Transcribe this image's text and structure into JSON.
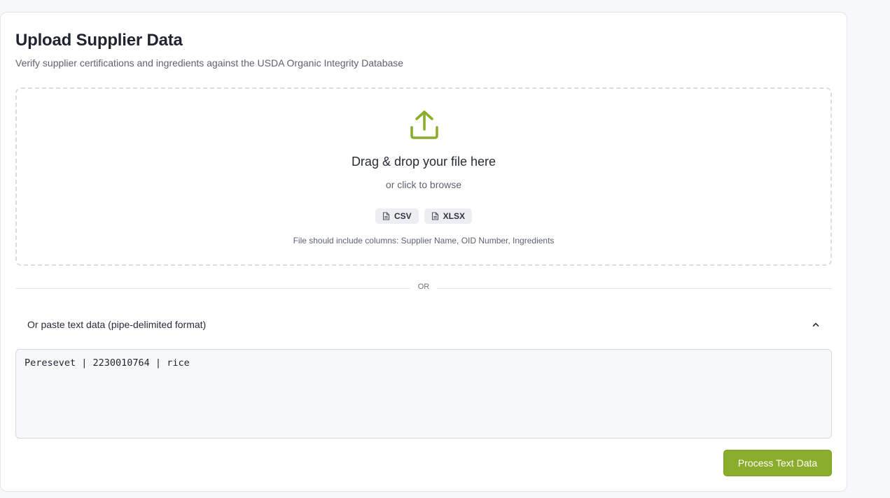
{
  "header": {
    "title": "Upload Supplier Data",
    "subtitle": "Verify supplier certifications and ingredients against the USDA Organic Integrity Database"
  },
  "dropzone": {
    "icon": "upload-icon",
    "title": "Drag & drop your file here",
    "subtitle": "or click to browse",
    "formats": [
      {
        "label": "CSV",
        "icon": "file-icon"
      },
      {
        "label": "XLSX",
        "icon": "file-icon"
      }
    ],
    "note": "File should include columns: Supplier Name, OID Number, Ingredients"
  },
  "divider": {
    "label": "OR"
  },
  "paste": {
    "label": "Or paste text data (pipe-delimited format)",
    "expanded": true,
    "value": "Peresevet | 2230010764 | rice"
  },
  "actions": {
    "process_label": "Process Text Data"
  },
  "colors": {
    "accent": "#8aae2c",
    "text": "#1f2430",
    "muted": "#5b6270",
    "border": "#e3e6ea"
  }
}
